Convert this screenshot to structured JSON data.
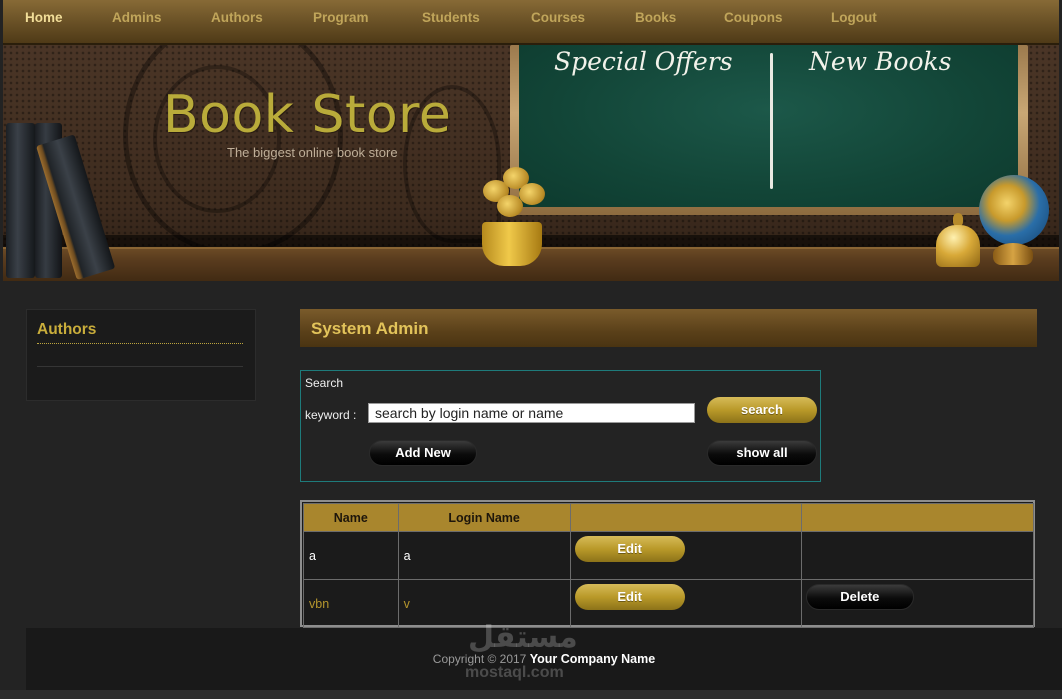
{
  "nav": {
    "items": [
      "Home",
      "Admins",
      "Authors",
      "Program",
      "Students",
      "Courses",
      "Books",
      "Coupons",
      "Logout"
    ],
    "active": "Home"
  },
  "banner": {
    "title": "Book Store",
    "tagline": "The biggest online book store",
    "board_left": "Special Offers",
    "board_right": "New Books"
  },
  "sidebar": {
    "title": "Authors"
  },
  "main": {
    "heading": "System Admin",
    "search": {
      "label": "Search",
      "keyword_label": "keyword :",
      "input_value": "search by login name or name",
      "search_button": "search",
      "add_new_button": "Add New",
      "show_all_button": "show all"
    },
    "table": {
      "headers": [
        "Name",
        "Login Name",
        "",
        ""
      ],
      "rows": [
        {
          "name": "a",
          "login": "a",
          "edit": "Edit",
          "delete": ""
        },
        {
          "name": "vbn",
          "login": "v",
          "edit": "Edit",
          "delete": "Delete"
        }
      ]
    }
  },
  "footer": {
    "copyright": "Copyright © 2017",
    "company": "Your Company Name"
  },
  "watermark": {
    "arabic": "مستقل",
    "latin": "mostaql.com"
  },
  "colors": {
    "nav_text": "#c0a55a",
    "nav_active": "#f1dd98",
    "accent_gold": "#c9ad3b",
    "table_header": "#a9862d",
    "panel_border": "#1e7b7b"
  }
}
